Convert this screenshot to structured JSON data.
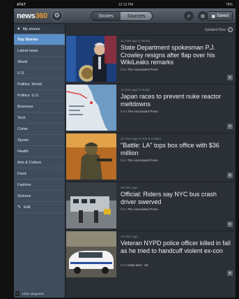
{
  "status": {
    "left": "AT&T",
    "time": "12:13 PM",
    "battery": "78%"
  },
  "toolbar": {
    "logo_main": "news",
    "logo_accent": "360",
    "tabs": [
      "Stories",
      "Sources"
    ],
    "saved_label": "Saved"
  },
  "sidebar": {
    "header": "My stories",
    "items": [
      "Top Stories",
      "Latest news",
      "World",
      "U.S.",
      "Politics: World",
      "Politics: U.S.",
      "Business",
      "Tech",
      "Crime",
      "Sports",
      "Health",
      "Arts & Culture",
      "Food",
      "Fashion",
      "Science"
    ],
    "edit": "Edit",
    "hide": "Hide categories"
  },
  "main": {
    "updated": "Updated Now",
    "stories": [
      {
        "meta": "11 mins ago in World",
        "title": "State Department spokesman P.J. Crowley resigns after flap over his WikiLeaks remarks",
        "source_prefix": "from",
        "source": "The Associated Press"
      },
      {
        "meta": "11 mins ago in World",
        "title": "Japan races to prevent nuke reactor meltdowns",
        "source_prefix": "from",
        "source": "The Associated Press"
      },
      {
        "meta": "13 mins ago in Arts & Culture",
        "title": "\"Battle: LA\" tops box office with $36 million",
        "source_prefix": "from",
        "source": "The Associated Press"
      },
      {
        "meta": "48 mins ago",
        "title": "Official: Riders say NYC bus crash driver swerved",
        "source_prefix": "from",
        "source": "The Associated Press"
      },
      {
        "meta": "15 mins ago",
        "title": "Veteran NYPD police officer killed in fall as he tried to handcuff violent ex-con",
        "source_prefix": "from",
        "source": "Daily Mail - UK"
      }
    ]
  }
}
